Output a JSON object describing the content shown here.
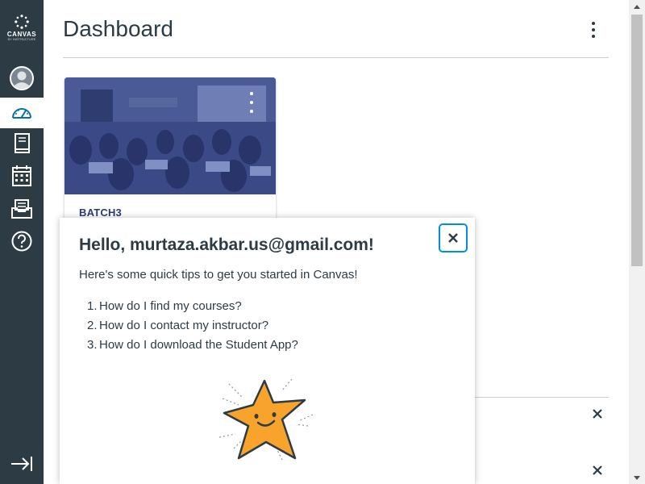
{
  "app": {
    "logo_word": "CANVAS",
    "logo_sub": "BY INSTRUCTURE"
  },
  "nav": {
    "items": [
      {
        "name": "account",
        "icon": "account-avatar-icon"
      },
      {
        "name": "dashboard",
        "icon": "dashboard-icon",
        "active": true
      },
      {
        "name": "courses",
        "icon": "courses-book-icon"
      },
      {
        "name": "calendar",
        "icon": "calendar-icon"
      },
      {
        "name": "inbox",
        "icon": "inbox-icon"
      },
      {
        "name": "help",
        "icon": "help-icon"
      }
    ],
    "collapse_icon": "collapse-nav-icon"
  },
  "header": {
    "title": "Dashboard",
    "menu_icon": "kebab-icon"
  },
  "course_card": {
    "title": "BATCH3",
    "hero_color": "#3b4a86",
    "menu_icon": "kebab-icon"
  },
  "welcome_tray": {
    "heading": "Hello, murtaza.akbar.us@gmail.com!",
    "intro": "Here's some quick tips to get you started in Canvas!",
    "tips": [
      {
        "num": "1.",
        "text": "How do I find my courses?"
      },
      {
        "num": "2.",
        "text": "How do I contact my instructor?"
      },
      {
        "num": "3.",
        "text": "How do I download the Student App?"
      }
    ],
    "close_icon": "close-icon",
    "illustration_icon": "smiling-star-icon"
  },
  "colors": {
    "nav_bg": "#2d3b45",
    "accent": "#008ee2",
    "active_icon": "#0770a3",
    "card_title": "#2d3b7d",
    "star_fill": "#f8a42c"
  }
}
